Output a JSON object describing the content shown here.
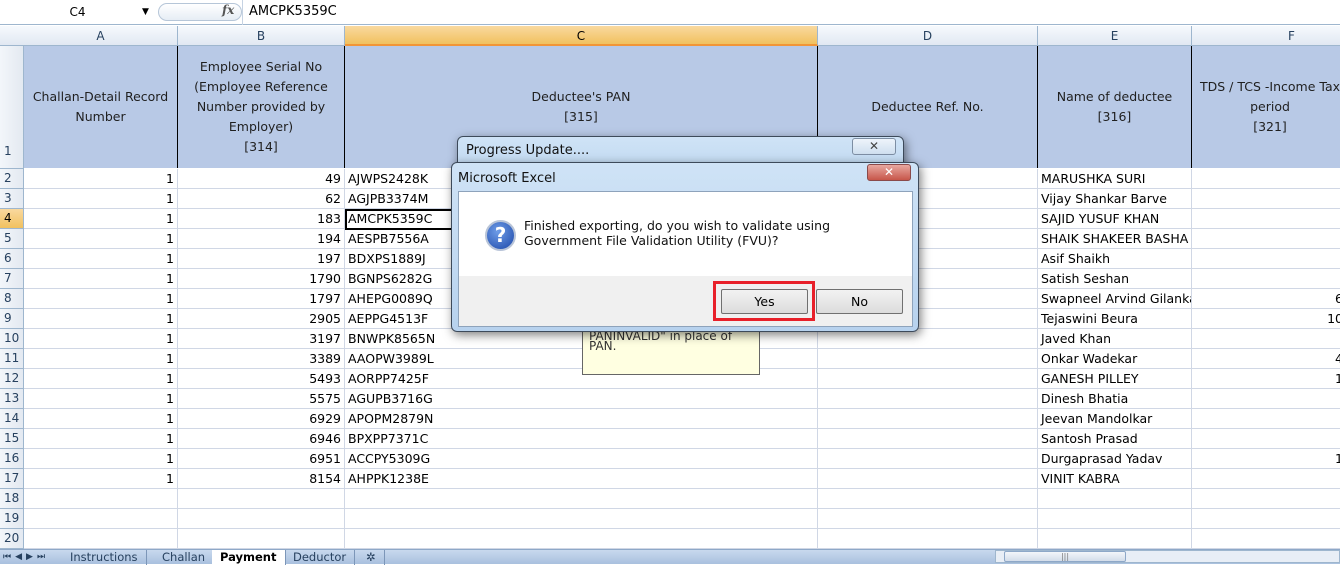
{
  "formula_bar": {
    "name_box": "C4",
    "fx_label": "fx",
    "value": "AMCPK5359C"
  },
  "columns": [
    "A",
    "B",
    "C",
    "D",
    "E",
    "F"
  ],
  "selected_column": "C",
  "selected_row": "4",
  "header_row": {
    "A": [
      "Challan-Detail Record",
      "Number"
    ],
    "B": [
      "Employee Serial No",
      "(Employee Reference",
      "Number provided by",
      "Employer)",
      "[314]"
    ],
    "C": [
      "Deductee's PAN",
      "[315]"
    ],
    "D": [
      "Deductee Ref. No."
    ],
    "E": [
      "Name of deductee",
      "[316]"
    ],
    "F": [
      "TDS / TCS -Income Tax",
      "period",
      "[321]"
    ]
  },
  "row_numbers": [
    "1",
    "2",
    "3",
    "4",
    "5",
    "6",
    "7",
    "8",
    "9",
    "10",
    "11",
    "12",
    "13",
    "14",
    "15",
    "16",
    "17",
    "18",
    "19",
    "20"
  ],
  "rows": [
    {
      "a": "1",
      "b": "49",
      "c": "AJWPS2428K",
      "e": "MARUSHKA SURI",
      "f": ""
    },
    {
      "a": "1",
      "b": "62",
      "c": "AGJPB3374M",
      "e": "Vijay Shankar Barve",
      "f": ""
    },
    {
      "a": "1",
      "b": "183",
      "c": "AMCPK5359C",
      "e": "SAJID YUSUF KHAN",
      "f": ""
    },
    {
      "a": "1",
      "b": "194",
      "c": "AESPB7556A",
      "e": "SHAIK SHAKEER BASHA S",
      "f": ""
    },
    {
      "a": "1",
      "b": "197",
      "c": "BDXPS1889J",
      "e": "Asif Shaikh",
      "f": ""
    },
    {
      "a": "1",
      "b": "1790",
      "c": "BGNPS6282G",
      "e": "Satish Seshan",
      "f": ""
    },
    {
      "a": "1",
      "b": "1797",
      "c": "AHEPG0089Q",
      "e": "Swapneel Arvind Gilanka",
      "f": "6"
    },
    {
      "a": "1",
      "b": "2905",
      "c": "AEPPG4513F",
      "e": "Tejaswini Beura",
      "f": "10"
    },
    {
      "a": "1",
      "b": "3197",
      "c": "BNWPK8565N",
      "e": "Javed Khan",
      "f": ""
    },
    {
      "a": "1",
      "b": "3389",
      "c": "AAOPW3989L",
      "e": "Onkar Wadekar",
      "f": "4"
    },
    {
      "a": "1",
      "b": "5493",
      "c": "AORPP7425F",
      "e": "GANESH PILLEY",
      "f": "1"
    },
    {
      "a": "1",
      "b": "5575",
      "c": "AGUPB3716G",
      "e": "Dinesh Bhatia",
      "f": ""
    },
    {
      "a": "1",
      "b": "6929",
      "c": "APOPM2879N",
      "e": "Jeevan Mandolkar",
      "f": ""
    },
    {
      "a": "1",
      "b": "6946",
      "c": "BPXPP7371C",
      "e": "Santosh Prasad",
      "f": ""
    },
    {
      "a": "1",
      "b": "6951",
      "c": "ACCPY5309G",
      "e": "Durgaprasad Yadav",
      "f": "1"
    },
    {
      "a": "1",
      "b": "8154",
      "c": "AHPPK1238E",
      "e": "VINIT KABRA",
      "f": ""
    }
  ],
  "comment": {
    "text": "PANINVALID\" in place of PAN."
  },
  "sheet_tabs": [
    {
      "label": "Instructions",
      "active": false
    },
    {
      "label": "Challan",
      "active": false
    },
    {
      "label": "Payment",
      "active": true
    },
    {
      "label": "Deductor",
      "active": false
    }
  ],
  "progress_dialog": {
    "title": "Progress Update....",
    "close_icon": "close-icon"
  },
  "message_dialog": {
    "title": "Microsoft Excel",
    "icon": "question-icon",
    "message": "Finished exporting, do you wish to validate using Government File Validation Utility (FVU)?",
    "yes_label": "Yes",
    "no_label": "No",
    "highlight_color": "#e8202a"
  }
}
